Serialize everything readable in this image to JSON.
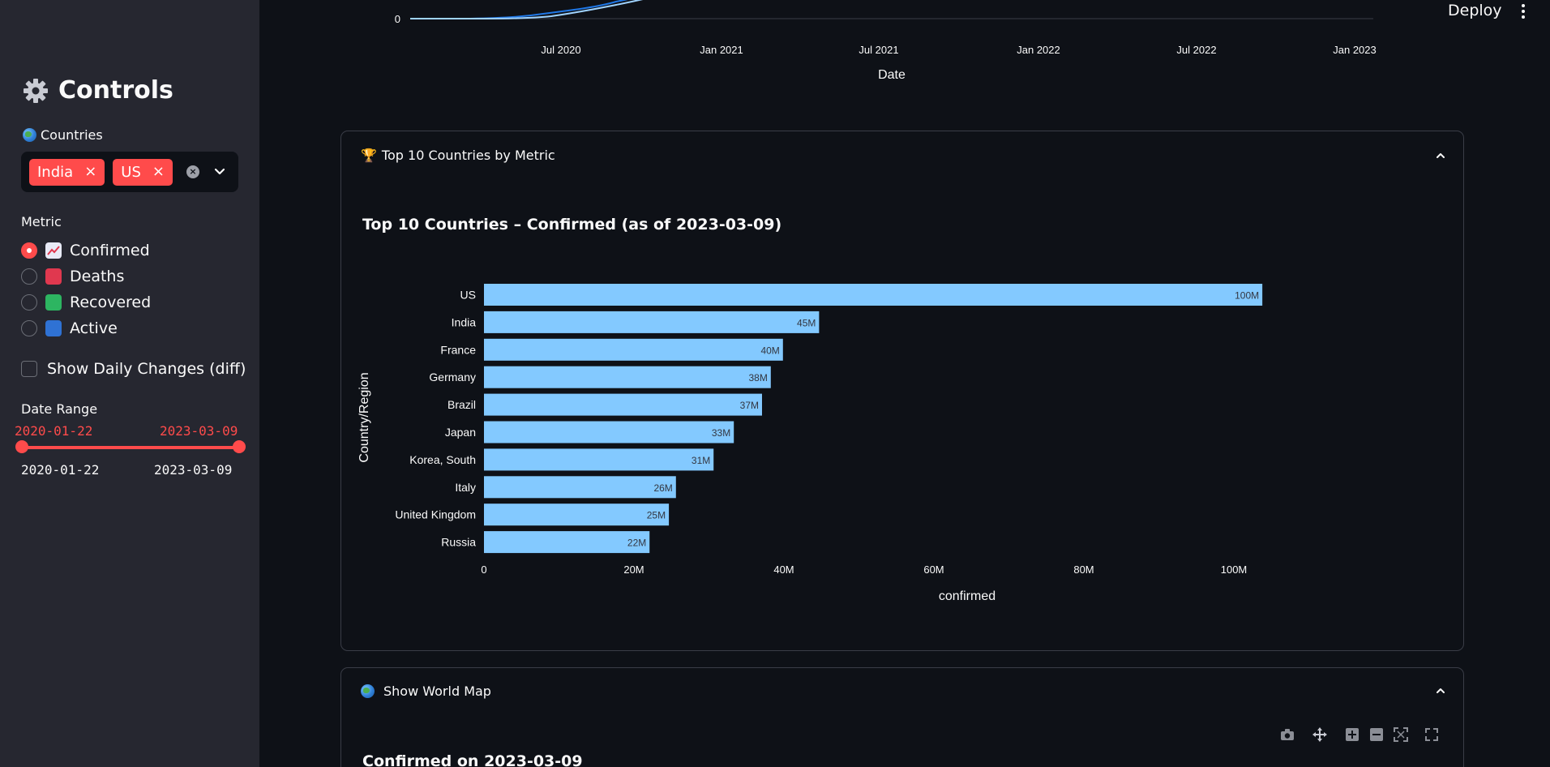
{
  "sidebar": {
    "title": "Controls",
    "countries_label": "Countries",
    "selected_countries": [
      "India",
      "US"
    ],
    "metric_label": "Metric",
    "metrics": [
      {
        "label": "Confirmed",
        "selected": true,
        "icon": "chart-increasing-icon",
        "color": "#e8eaf6"
      },
      {
        "label": "Deaths",
        "selected": false,
        "icon": "red-square-icon",
        "color": "#e0384f"
      },
      {
        "label": "Recovered",
        "selected": false,
        "icon": "green-square-icon",
        "color": "#2db561"
      },
      {
        "label": "Active",
        "selected": false,
        "icon": "blue-square-icon",
        "color": "#2f72d4"
      }
    ],
    "show_daily_changes_label": "Show Daily Changes (diff)",
    "date_range_label": "Date Range",
    "date_start": "2020-01-22",
    "date_end": "2023-03-09",
    "date_min": "2020-01-22",
    "date_max": "2023-03-09"
  },
  "header": {
    "deploy_label": "Deploy"
  },
  "timeseries_chart": {
    "type": "line",
    "x_ticks": [
      "Jul 2020",
      "Jan 2021",
      "Jul 2021",
      "Jan 2022",
      "Jul 2022",
      "Jan 2023"
    ],
    "y_tick": "0",
    "xlabel": "Date"
  },
  "top10_section": {
    "header": "Top 10 Countries by Metric"
  },
  "chart_data": {
    "type": "bar",
    "orientation": "horizontal",
    "title": "Top 10 Countries – Confirmed (as of 2023-03-09)",
    "categories": [
      "US",
      "India",
      "France",
      "Germany",
      "Brazil",
      "Japan",
      "Korea, South",
      "Italy",
      "United Kingdom",
      "Russia"
    ],
    "values": [
      103800000,
      44690000,
      39870000,
      38250000,
      37080000,
      33320000,
      30620000,
      25600000,
      24660000,
      22080000
    ],
    "data_labels": [
      "100M",
      "45M",
      "40M",
      "38M",
      "37M",
      "33M",
      "31M",
      "26M",
      "25M",
      "22M"
    ],
    "x_ticks": [
      "0",
      "20M",
      "40M",
      "60M",
      "80M",
      "100M"
    ],
    "xlim": [
      0,
      107500000
    ],
    "xlabel": "confirmed",
    "ylabel": "Country/Region",
    "bar_color": "#83c9ff"
  },
  "map_section": {
    "header": "Show World Map",
    "chart_title": "Confirmed on 2023-03-09"
  }
}
